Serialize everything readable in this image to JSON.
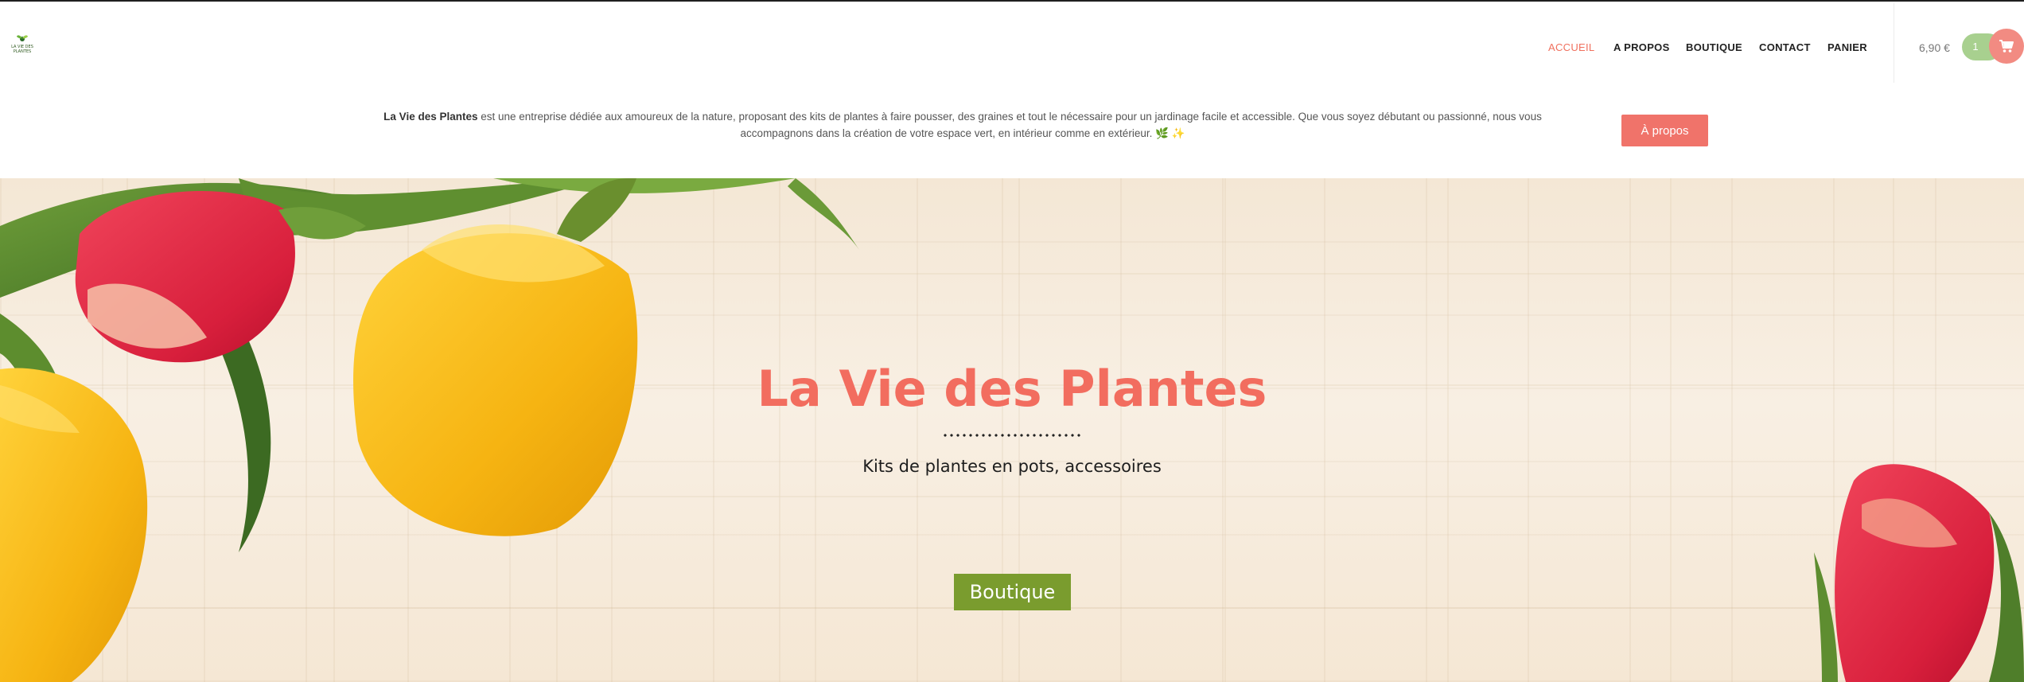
{
  "logo": {
    "text": "LA VIE DES PLANTES"
  },
  "nav": {
    "items": [
      {
        "label": "ACCUEIL",
        "active": true
      },
      {
        "label": "A PROPOS",
        "active": false
      },
      {
        "label": "BOUTIQUE",
        "active": false
      },
      {
        "label": "CONTACT",
        "active": false
      },
      {
        "label": "PANIER",
        "active": false
      }
    ]
  },
  "cart": {
    "total": "6,90 €",
    "count": "1",
    "icon": "cart-icon"
  },
  "announcement": {
    "brand": "La Vie des Plantes",
    "text_line1": " est une entreprise dédiée aux amoureux de la nature, proposant des kits de plantes à faire pousser, des graines et tout le nécessaire pour un jardinage facile et accessible. Que vous soyez débutant ou passionné, nous vous",
    "text_line2": "accompagnons dans la création de votre espace vert, en intérieur comme en extérieur. 🌿 ✨",
    "button_label": "À propos"
  },
  "hero": {
    "title": "La Vie des Plantes",
    "subtitle": "Kits de plantes en pots, accessoires",
    "button_label": "Boutique"
  },
  "colors": {
    "accent": "#f26d5f",
    "button_red": "#f0736a",
    "button_green": "#7a9c2e",
    "cart_green": "#a8d08f",
    "cart_pink": "#f28b82"
  }
}
